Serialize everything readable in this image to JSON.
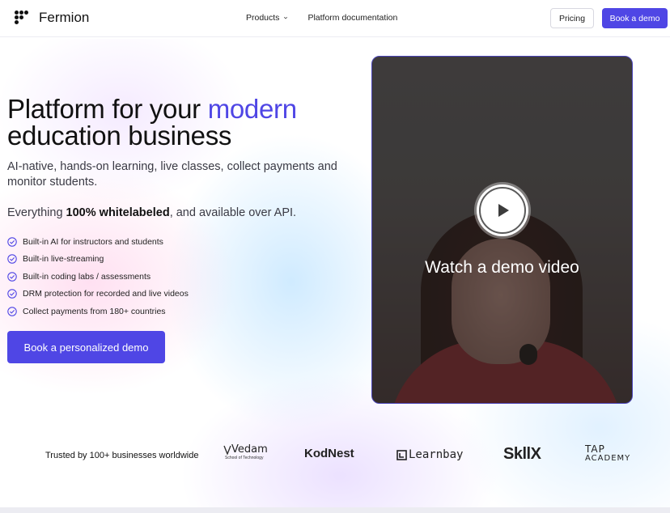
{
  "header": {
    "brand": "Fermion",
    "nav": {
      "products": "Products",
      "docs": "Platform documentation"
    },
    "pricing": "Pricing",
    "book_demo": "Book a demo"
  },
  "hero": {
    "title_part1": "Platform for your ",
    "title_accent": "modern",
    "title_part2": "education business",
    "subtitle": "AI-native, hands-on learning, live classes, collect payments and monitor students.",
    "white_prefix": "Everything ",
    "white_bold": "100% whitelabeled",
    "white_suffix": ", and available over API.",
    "features": [
      "Built-in AI for instructors and students",
      "Built-in live-streaming",
      "Built-in coding labs / assessments",
      "DRM protection for recorded and live videos",
      "Collect payments from 180+ countries"
    ],
    "cta": "Book a personalized demo"
  },
  "video": {
    "label": "Watch a demo video",
    "icon": "play-icon"
  },
  "trust": {
    "text": "Trusted by 100+ businesses worldwide",
    "logos": {
      "vedam": "Vedam",
      "vedam_sub": "School of Technology",
      "kodnest": "KodNest",
      "learnbay": "Learnbay",
      "skill": "SkllX",
      "tap_top": "TAP",
      "tap_bottom": "ACADEMY"
    }
  },
  "colors": {
    "accent": "#4f46e5",
    "check": "#4f46e5"
  }
}
